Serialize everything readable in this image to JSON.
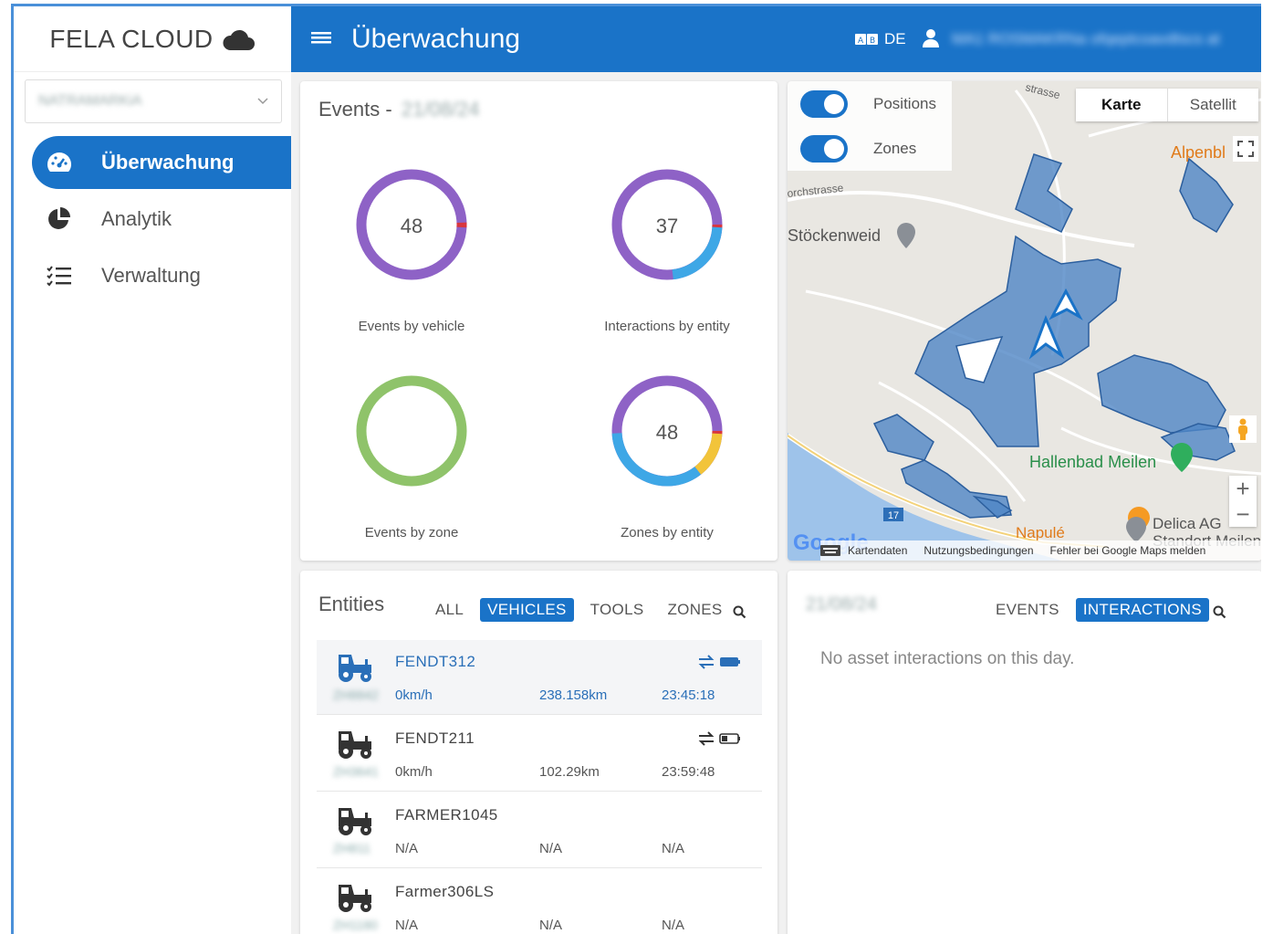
{
  "app": {
    "brand": "FELA CLOUD",
    "tenant": "NATRAMARKiA",
    "user": "MA1 ROSMAKRNa ofqeptcoavdtscs at"
  },
  "nav": [
    {
      "label": "Überwachung",
      "icon": "dashboard-icon",
      "active": true
    },
    {
      "label": "Analytik",
      "icon": "pie-chart-icon",
      "active": false
    },
    {
      "label": "Verwaltung",
      "icon": "list-check-icon",
      "active": false
    }
  ],
  "header": {
    "title": "Überwachung",
    "lang": "DE"
  },
  "events": {
    "title": "Events -",
    "date": "21/08/24",
    "donuts": [
      {
        "value": "48",
        "label": "Events by vehicle"
      },
      {
        "value": "37",
        "label": "Interactions by entity"
      },
      {
        "value": "",
        "label": "Events by zone"
      },
      {
        "value": "48",
        "label": "Zones by entity"
      }
    ]
  },
  "map": {
    "toggle_positions": "Positions",
    "toggle_zones": "Zones",
    "tab_map": "Karte",
    "tab_satellite": "Satellit",
    "places": {
      "alpenbl": "Alpenbl",
      "stockenweid": "Stöckenweid",
      "orchstrasse": "orchstrasse",
      "strasse": "strasse",
      "hallenbad": "Hallenbad Meilen",
      "napule": "Napulé",
      "delica1": "Delica AG",
      "delica2": "Standort Meilen",
      "route": "17"
    },
    "footer": {
      "google": "Google",
      "kartendaten": "Kartendaten",
      "terms": "Nutzungsbedingungen",
      "report": "Fehler bei Google Maps melden"
    },
    "zoom_in": "+",
    "zoom_out": "−"
  },
  "entities": {
    "title": "Entities",
    "tabs": [
      "ALL",
      "VEHICLES",
      "TOOLS",
      "ZONES"
    ],
    "active_tab": "VEHICLES",
    "rows": [
      {
        "name": "FENDT312",
        "id": "ZH8842",
        "speed": "0km/h",
        "distance": "238.158km",
        "time": "23:45:18",
        "selected": true
      },
      {
        "name": "FENDT211",
        "id": "ZH3641",
        "speed": "0km/h",
        "distance": "102.29km",
        "time": "23:59:48",
        "selected": false
      },
      {
        "name": "FARMER1045",
        "id": "ZH811",
        "speed": "N/A",
        "distance": "N/A",
        "time": "N/A",
        "selected": false
      },
      {
        "name": "Farmer306LS",
        "id": "ZH1180",
        "speed": "N/A",
        "distance": "N/A",
        "time": "N/A",
        "selected": false
      }
    ]
  },
  "interactions": {
    "date": "21/08/24",
    "tabs": [
      "EVENTS",
      "INTERACTIONS"
    ],
    "active_tab": "INTERACTIONS",
    "empty_text": "No asset interactions on this day."
  },
  "colors": {
    "primary": "#1a73c8",
    "purple": "#8e62c6",
    "blue": "#3ea7e6",
    "red": "#d9363e",
    "green": "#8fc36a",
    "yellow": "#f2c43a",
    "zone_fill": "#4f86c6"
  }
}
